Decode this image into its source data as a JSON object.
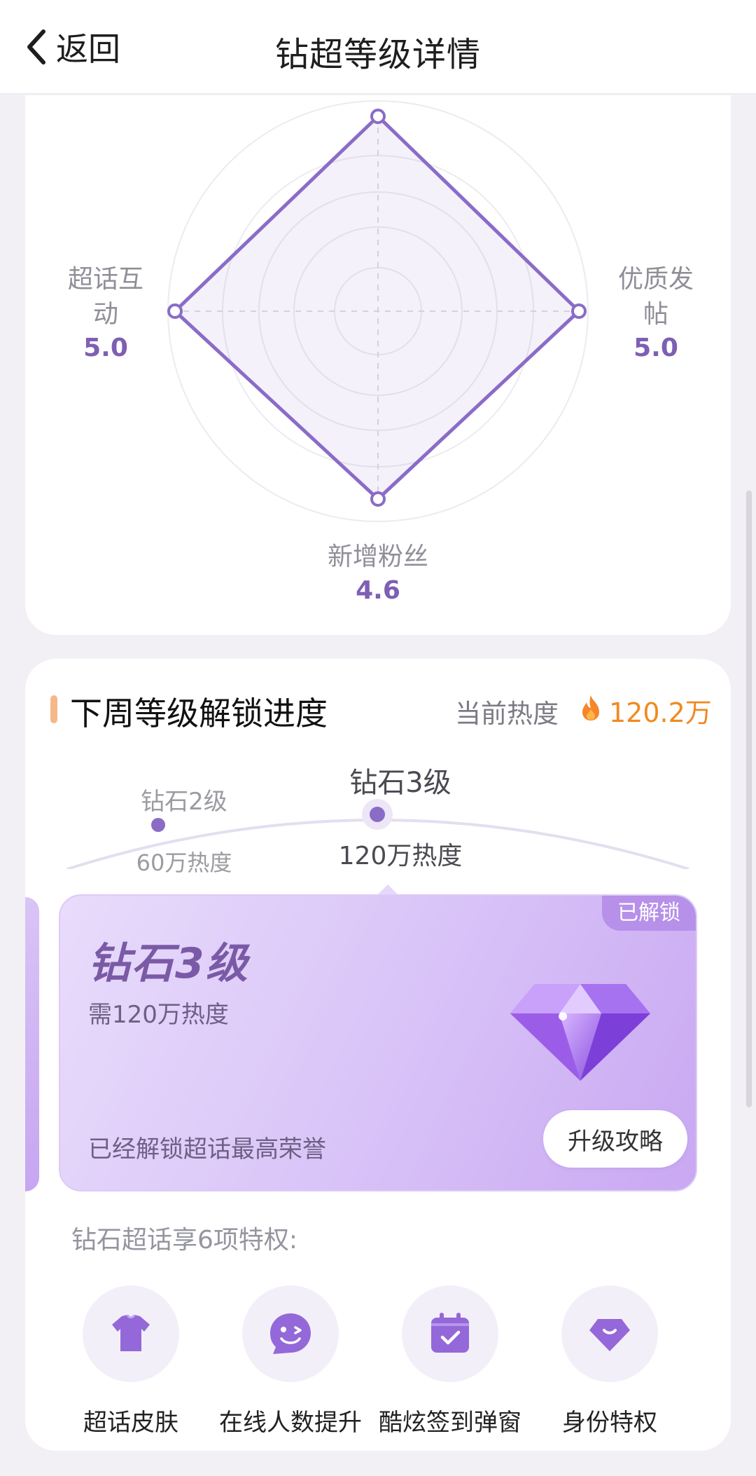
{
  "header": {
    "back_label": "返回",
    "title": "钻超等级详情"
  },
  "radar": {
    "axes": [
      {
        "label_line1": "超话互",
        "label_line2": "动",
        "value": "5.0"
      },
      {
        "label_line1": "优质发",
        "label_line2": "帖",
        "value": "5.0"
      },
      {
        "label_line1": "新增粉丝",
        "label_line2": "",
        "value": "4.6"
      }
    ],
    "accent_color": "#8a6cc7"
  },
  "progress": {
    "section_title": "下周等级解锁进度",
    "heat_label": "当前热度",
    "heat_value": "120.2万",
    "levels": [
      {
        "name": "钻石2级",
        "heat": "60万热度"
      },
      {
        "name": "钻石3级",
        "heat": "120万热度"
      }
    ],
    "card": {
      "badge": "已解锁",
      "level_name": "钻石3级",
      "requirement": "需120万热度",
      "description": "已经解锁超话最高荣誉",
      "button_label": "升级攻略"
    },
    "privileges_title": "钻石超话享6项特权:",
    "privileges": [
      {
        "label": "超话皮肤",
        "icon": "tshirt-icon"
      },
      {
        "label": "在线人数提升",
        "icon": "smiley-chat-icon"
      },
      {
        "label": "酷炫签到弹窗",
        "icon": "calendar-check-icon"
      },
      {
        "label": "身份特权",
        "icon": "diamond-badge-icon"
      }
    ]
  },
  "colors": {
    "accent_purple": "#8a6cc7",
    "heat_orange": "#f08a20",
    "card_gradient_start": "#e8dcfb",
    "card_gradient_end": "#c9a8f2"
  }
}
